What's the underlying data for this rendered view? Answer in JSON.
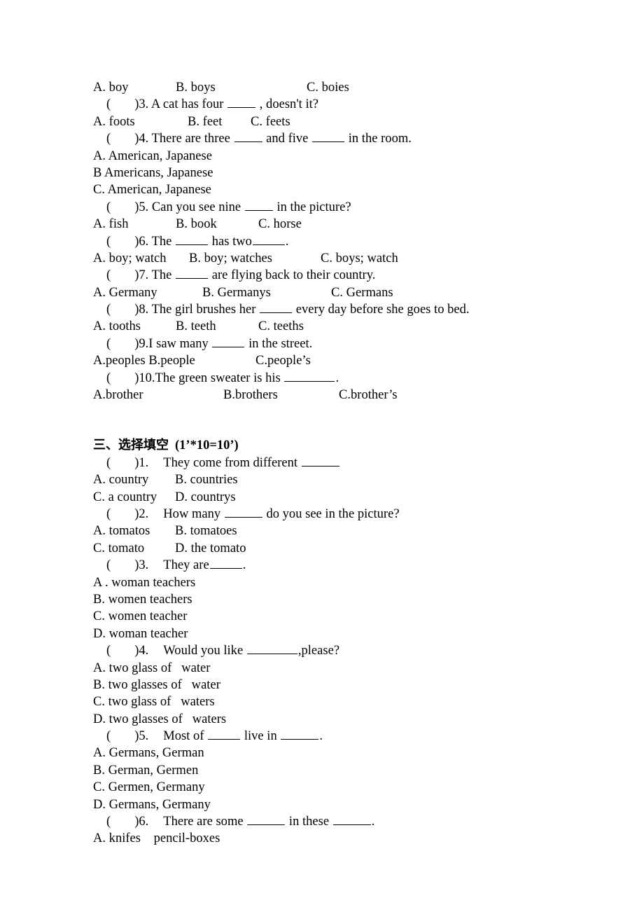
{
  "document": {
    "type": "english-grammar-worksheet",
    "language_mix": [
      "English",
      "Chinese"
    ],
    "page_background": "#ffffff",
    "text_color": "#000000"
  },
  "section_two_tail": {
    "q2_options": {
      "a": "A. boy",
      "b": "B. boys",
      "c": "C. boies"
    },
    "q3": {
      "bracket": "(",
      "close": ")3. A cat has four",
      "after": ", doesn't it?",
      "options": {
        "a": "A. foots",
        "b": "B. feet",
        "c": "C. feets"
      }
    },
    "q4": {
      "bracket": "(",
      "close": ")4. There are three",
      "mid": "and five",
      "after": "in the room.",
      "options": {
        "a": "A. American, Japanese",
        "b": "B Americans, Japanese",
        "c": "C. American, Japanese"
      }
    },
    "q5": {
      "bracket": "(",
      "close": ")5. Can you see nine",
      "after": "in the picture?",
      "options": {
        "a": "A. fish",
        "b": "B. book",
        "c": "C. horse"
      }
    },
    "q6": {
      "bracket": "(",
      "close": ")6. The",
      "mid": "has two",
      "after": ".",
      "options": {
        "a": "A. boy; watch",
        "b": "B. boy; watches",
        "c": "C. boys; watch"
      }
    },
    "q7": {
      "bracket": "(",
      "close": ")7. The",
      "after": "are flying back to their country.",
      "options": {
        "a": "A. Germany",
        "b": "B. Germanys",
        "c": "C. Germans"
      }
    },
    "q8": {
      "bracket": "(",
      "close": ")8. The girl brushes her",
      "after": "every day before she goes to bed.",
      "options": {
        "a": "A. tooths",
        "b": "B. teeth",
        "c": "C. teeths"
      }
    },
    "q9": {
      "bracket": "(",
      "close": ")9.I saw many",
      "after": "in the street.",
      "options": {
        "a": "A.peoples B.people",
        "c": "C.people’s"
      }
    },
    "q10": {
      "bracket": "(",
      "close": ")10.The green sweater is his",
      "after": ".",
      "options": {
        "a": "A.brother",
        "b": "B.brothers",
        "c": "C.brother’s"
      }
    }
  },
  "section_three": {
    "heading_cn": "三、选择填空",
    "heading_marks": "(1’*10=10’)",
    "q1": {
      "bracket": "(",
      "close": ")1.",
      "text": "They come from different",
      "options": {
        "a": "A. country",
        "b": "B. countries",
        "c": "C. a country",
        "d": "D. countrys"
      }
    },
    "q2": {
      "bracket": "(",
      "close": ")2.",
      "text": "How many",
      "after": "do you see in the picture?",
      "options": {
        "a": "A. tomatos",
        "b": "B. tomatoes",
        "c": "C. tomato",
        "d": "D. the tomato"
      }
    },
    "q3": {
      "bracket": "(",
      "close": ")3.",
      "text": "They are",
      "after": ".",
      "options": {
        "a": "A . woman teachers",
        "b": "B. women teachers",
        "c": "C. women teacher",
        "d": "D. woman teacher"
      }
    },
    "q4": {
      "bracket": "(",
      "close": ")4.",
      "text": "Would you like",
      "after": ",please?",
      "options": {
        "a": "A. two glass of   water",
        "b": "B. two glasses of   water",
        "c": "C. two glass of   waters",
        "d": "D. two glasses of   waters"
      }
    },
    "q5": {
      "bracket": "(",
      "close": ")5.",
      "text": "Most of",
      "mid": "live in",
      "after": ".",
      "options": {
        "a": "A. Germans, German",
        "b": "B. German, Germen",
        "c": "C. Germen, Germany",
        "d": "D. Germans, Germany"
      }
    },
    "q6": {
      "bracket": "(",
      "close": ")6.",
      "text": "There are some",
      "mid": "in these",
      "after": ".",
      "options": {
        "a": "A. knifes    pencil-boxes"
      }
    }
  }
}
